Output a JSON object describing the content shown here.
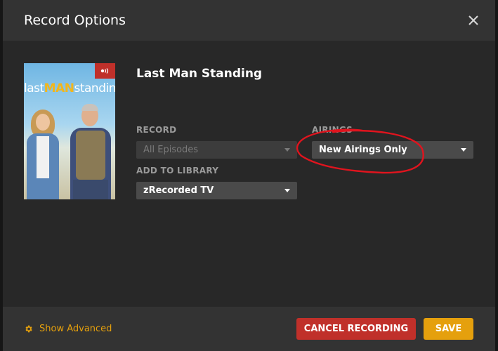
{
  "dialog": {
    "title": "Record Options"
  },
  "show": {
    "title": "Last Man Standing",
    "poster_title": [
      "last",
      "MAN",
      "standing"
    ]
  },
  "fields": {
    "record": {
      "label": "RECORD",
      "value": "All Episodes",
      "disabled": true
    },
    "airings": {
      "label": "AIRINGS",
      "value": "New Airings Only"
    },
    "library": {
      "label": "ADD TO LIBRARY",
      "value": "zRecorded TV"
    }
  },
  "footer": {
    "show_advanced": "Show Advanced",
    "cancel_label": "CANCEL RECORDING",
    "save_label": "SAVE"
  },
  "icons": {
    "close": "close-icon",
    "advanced": "gear-icon",
    "badge": "dvr-icon"
  },
  "colors": {
    "accent": "#e5a00d",
    "danger": "#c0302a",
    "annotation": "#e0141e"
  }
}
